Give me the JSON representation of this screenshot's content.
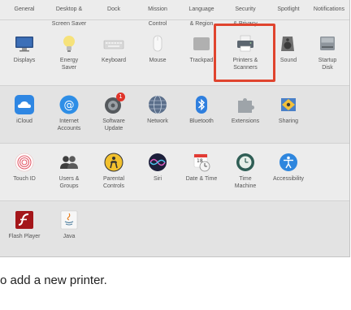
{
  "window": {
    "top_row": [
      {
        "label": "General"
      },
      {
        "label": "Desktop &\nScreen Saver"
      },
      {
        "label": "Dock"
      },
      {
        "label": "Mission\nControl"
      },
      {
        "label": "Language\n& Region"
      },
      {
        "label": "Security\n& Privacy"
      },
      {
        "label": "Spotlight"
      },
      {
        "label": "Notifications"
      }
    ],
    "row1": [
      {
        "label": "Displays",
        "icon": "display-icon"
      },
      {
        "label": "Energy\nSaver",
        "icon": "lightbulb-icon"
      },
      {
        "label": "Keyboard",
        "icon": "keyboard-icon"
      },
      {
        "label": "Mouse",
        "icon": "mouse-icon"
      },
      {
        "label": "Trackpad",
        "icon": "trackpad-icon"
      },
      {
        "label": "Printers &\nScanners",
        "icon": "printer-icon"
      },
      {
        "label": "Sound",
        "icon": "speaker-icon"
      },
      {
        "label": "Startup\nDisk",
        "icon": "disk-icon"
      }
    ],
    "row2": [
      {
        "label": "iCloud",
        "icon": "cloud-icon"
      },
      {
        "label": "Internet\nAccounts",
        "icon": "at-icon"
      },
      {
        "label": "Software\nUpdate",
        "icon": "gear-update-icon",
        "badge": "1"
      },
      {
        "label": "Network",
        "icon": "globe-icon"
      },
      {
        "label": "Bluetooth",
        "icon": "bluetooth-icon"
      },
      {
        "label": "Extensions",
        "icon": "puzzle-icon"
      },
      {
        "label": "Sharing",
        "icon": "sharing-icon"
      }
    ],
    "row3": [
      {
        "label": "Touch ID",
        "icon": "fingerprint-icon"
      },
      {
        "label": "Users &\nGroups",
        "icon": "users-icon"
      },
      {
        "label": "Parental\nControls",
        "icon": "parental-icon"
      },
      {
        "label": "Siri",
        "icon": "siri-icon"
      },
      {
        "label": "Date & Time",
        "icon": "calendar-clock-icon",
        "cal_num": "18"
      },
      {
        "label": "Time\nMachine",
        "icon": "time-machine-icon"
      },
      {
        "label": "Accessibility",
        "icon": "accessibility-icon"
      }
    ],
    "row4": [
      {
        "label": "Flash Player",
        "icon": "flash-icon"
      },
      {
        "label": "Java",
        "icon": "java-icon"
      }
    ]
  },
  "caption": "o add a new printer.",
  "colors": {
    "highlight": "#e0442e",
    "window_bg": "#ececec"
  }
}
